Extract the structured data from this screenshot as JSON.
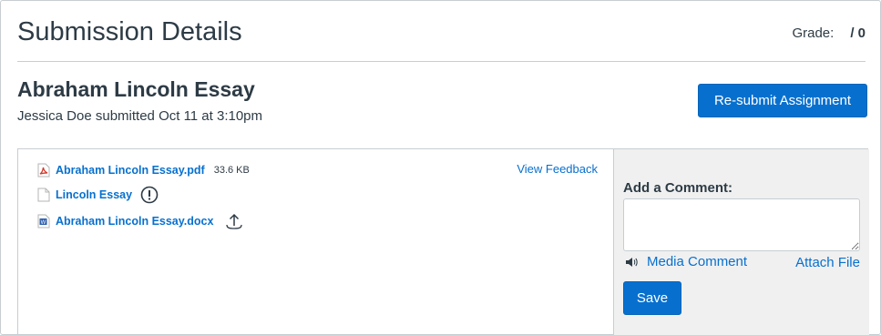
{
  "header": {
    "title": "Submission Details",
    "grade_label": "Grade:",
    "grade_value": "/ 0"
  },
  "assignment": {
    "title": "Abraham Lincoln Essay",
    "submitted_text": "Jessica Doe submitted Oct 11 at 3:10pm",
    "resubmit_label": "Re-submit Assignment"
  },
  "files": {
    "view_feedback_label": "View Feedback",
    "items": [
      {
        "name": "Abraham Lincoln Essay.pdf",
        "size": "33.6 KB",
        "icon": "pdf-file-icon"
      },
      {
        "name": "Lincoln Essay",
        "icon": "document-icon",
        "status_icon": "warning-icon"
      },
      {
        "name": "Abraham Lincoln Essay.docx",
        "icon": "word-file-icon",
        "status_icon": "upload-icon"
      }
    ]
  },
  "comments": {
    "label": "Add a Comment:",
    "textarea_value": "",
    "media_label": "Media Comment",
    "attach_label": "Attach File",
    "save_label": "Save"
  },
  "colors": {
    "accent": "#0770cf",
    "text": "#2d3b45",
    "border": "#c7cdd1",
    "sidebar_bg": "#f0f0f0"
  }
}
